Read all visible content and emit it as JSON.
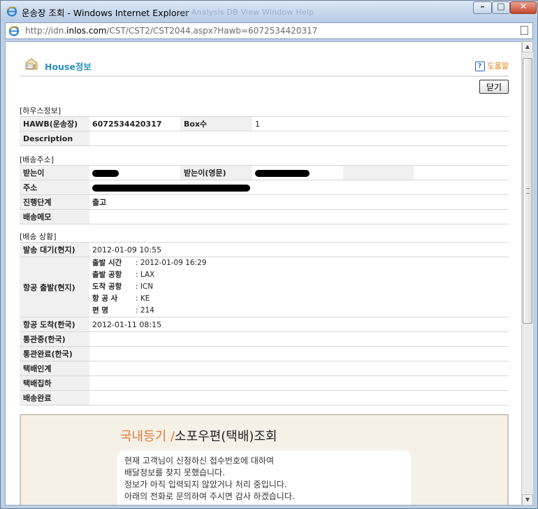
{
  "window": {
    "title": "운송장 조회 - Windows Internet Explorer",
    "ghost_menu": "ue   Analysis   DB   View   Window   Help"
  },
  "address": {
    "url_prefix": "http://idn.",
    "url_domain": "inlos.com",
    "url_path": "/CST/CST2/CST2044.aspx?Hawb=6072534420317"
  },
  "page": {
    "title": "House정보",
    "help": "도움말",
    "close_button": "닫기"
  },
  "house_section": {
    "title": "[하우스정보]",
    "hawb_label": "HAWB(운송장)",
    "hawb_value": "6072534420317",
    "box_label": "Box수",
    "box_value": "1",
    "description_label": "Description",
    "description_value": ""
  },
  "address_section": {
    "title": "[배송주소]",
    "receiver_label": "받는이",
    "receiver_en_label": "받는이(영문)",
    "address_label": "주소",
    "stage_label": "진행단계",
    "stage_value": "출고",
    "memo_label": "배송메모",
    "memo_value": ""
  },
  "status_section": {
    "title": "[배송 상황]",
    "rows": [
      {
        "label": "발송 대기(현지)",
        "value": "2012-01-09 10:55"
      },
      {
        "label": "항공 출발(현지)",
        "value": ""
      },
      {
        "label": "항공 도착(한국)",
        "value": "2012-01-11 08:15"
      },
      {
        "label": "통관중(한국)",
        "value": ""
      },
      {
        "label": "통관완료(한국)",
        "value": ""
      },
      {
        "label": "택배인계",
        "value": ""
      },
      {
        "label": "택배집하",
        "value": ""
      },
      {
        "label": "배송완료",
        "value": ""
      }
    ],
    "departure_details": [
      {
        "label": "출발 시간",
        "value": ": 2012-01-09 16:29"
      },
      {
        "label": "출발 공항",
        "value": ": LAX"
      },
      {
        "label": "도착 공항",
        "value": ": ICN"
      },
      {
        "label": "항 공 사",
        "value": ": KE"
      },
      {
        "label": "편    명",
        "value": ": 214"
      }
    ]
  },
  "notice": {
    "heading_a": "국내등기 /",
    "heading_b": "소포우편(택배)조회",
    "lines": [
      "현재 고객님이 신청하신 접수번호에 대하여",
      "배달정보를 찾지 못했습니다.",
      "정보가 아직 입력되지 않았거나 처리 중입니다.",
      "아래의 전화로 문의하여 주시면 감사 하겠습니다."
    ]
  },
  "colors": {
    "accent_blue": "#2b8fba",
    "accent_orange": "#e07a00",
    "label_bg": "#f0f0f0"
  }
}
